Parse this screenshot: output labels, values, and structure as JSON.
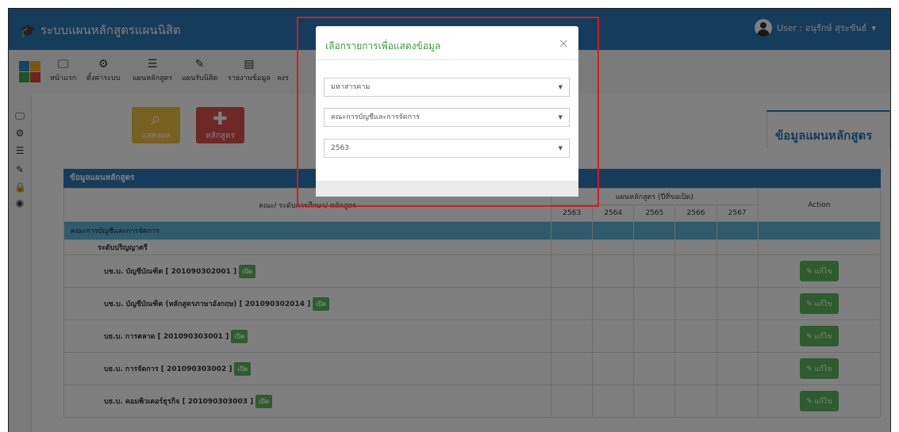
{
  "app": {
    "title": "ระบบแผนหลักสูตรแผนนิสิต",
    "user_label": "User : อนุรักษ์ สุระขันธ์"
  },
  "toolbar": {
    "items": [
      {
        "label": "หน้าแรก",
        "icon": "monitor-icon"
      },
      {
        "label": "ตั้งค่าระบบ",
        "icon": "gears-icon"
      },
      {
        "label": "แผนหลักสูตร",
        "icon": "list-icon"
      },
      {
        "label": "แผนรับนิสิต",
        "icon": "edit-icon"
      },
      {
        "label": "รายงานข้อมูล",
        "icon": "report-icon"
      },
      {
        "label": "ลงร",
        "icon": "partial-icon"
      }
    ]
  },
  "actions": {
    "show_label": "แสดงผล",
    "add_label": "หลักสูตร"
  },
  "tab": {
    "title": "ข้อมูลแผนหลักสูตร"
  },
  "panel": {
    "title": "ข้อมูลแผนหลักสูตร",
    "col_program": "คณะ/ ระดับการศึกษา/ หลักสูตร",
    "col_plan": "แผนหลักสูตร (ปีที่ขอเปิด)",
    "col_action": "Action",
    "years": [
      "2563",
      "2564",
      "2565",
      "2566",
      "2567"
    ],
    "faculty": "คณะการบัญชีและการจัดการ",
    "level": "ระดับปริญญาตรี",
    "open_label": "เปิด",
    "edit_label": "แก้ไข",
    "programs": [
      "บช.บ. บัญชีบัณฑิต [ 201090302001 ]",
      "บช.บ. บัญชีบัณฑิต (หลักสูตรภาษาอังกฤษ) [ 201090302014 ]",
      "บธ.บ. การตลาด [ 201090303001 ]",
      "บธ.บ. การจัดการ [ 201090303002 ]",
      "บธ.บ. คอมพิวเตอร์ธุรกิจ [ 201090303003 ]"
    ]
  },
  "modal": {
    "title": "เลือกรายการเพื่อแสดงข้อมูล",
    "close": "×",
    "university": "มหาสารคาม",
    "faculty": "คณะการบัญชีและการจัดการ",
    "year": "2563"
  },
  "colors": {
    "primary": "#2c79b8",
    "faculty_row": "#5fb6da",
    "button_green": "#5cb85c",
    "highlight": "#cc1f1f"
  }
}
